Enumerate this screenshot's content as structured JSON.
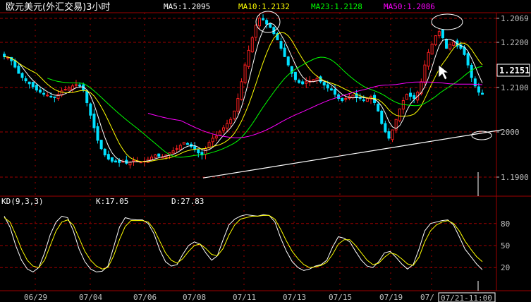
{
  "header": {
    "title": "欧元美元(外汇交易)3小时",
    "ma5": "MA5:1.2095",
    "ma10": "MA10:1.2132",
    "ma23": "MA23:1.2128",
    "ma50": "MA50:1.2086"
  },
  "kd_header": {
    "name": "KD(9,3,3)",
    "k": "K:17.05",
    "d": "D:27.83"
  },
  "current_price": "1.2151",
  "cursor_time": "07/21-11:00",
  "colors": {
    "background": "#000000",
    "up_candle": "#ff2020",
    "down_candle": "#00e0ff",
    "ma5": "#ffffff",
    "ma10": "#ffff00",
    "ma23": "#00ff00",
    "ma50": "#ff00ff",
    "grid": "#a00000",
    "axis": "#c0c0c0",
    "trendline": "#ffffff",
    "k_line": "#ffffff",
    "d_line": "#ffff00"
  },
  "chart_data": [
    {
      "type": "candlestick",
      "title": "欧元美元(外汇交易)3小时",
      "y_ticks": [
        "1.2069",
        "1.2200",
        "1.2100",
        "2000",
        "1.1900"
      ],
      "ylim": [
        1.185,
        1.2275
      ],
      "x_ticks": [
        "06/29",
        "07/04",
        "07/06",
        "07/08",
        "07/11",
        "07/13",
        "07/15",
        "07/19",
        "07/",
        "07/21-11:00"
      ],
      "grid": true,
      "series": [
        {
          "name": "MA5",
          "last": 1.2095
        },
        {
          "name": "MA10",
          "last": 1.2132
        },
        {
          "name": "MA23",
          "last": 1.2128
        },
        {
          "name": "MA50",
          "last": 1.2086
        }
      ],
      "close_approx": [
        1.217,
        1.2168,
        1.216,
        1.2145,
        1.213,
        1.212,
        1.2112,
        1.2105,
        1.2098,
        1.209,
        1.2085,
        1.208,
        1.2078,
        1.2075,
        1.2072,
        1.208,
        1.2088,
        1.2092,
        1.2095,
        1.21,
        1.2103,
        1.21,
        1.209,
        1.206,
        1.203,
        1.2,
        1.197,
        1.195,
        1.1935,
        1.1925,
        1.192,
        1.1918,
        1.1917,
        1.192,
        1.1915,
        1.1918,
        1.1922,
        1.192,
        1.1918,
        1.192,
        1.1925,
        1.193,
        1.1935,
        1.1932,
        1.193,
        1.1935,
        1.194,
        1.1945,
        1.195,
        1.1958,
        1.1965,
        1.196,
        1.1955,
        1.1948,
        1.194,
        1.1935,
        1.195,
        1.1965,
        1.1975,
        1.198,
        1.199,
        1.2,
        1.201,
        1.202,
        1.204,
        1.207,
        1.211,
        1.215,
        1.2185,
        1.2215,
        1.2245,
        1.2262,
        1.2258,
        1.2248,
        1.224,
        1.2225,
        1.221,
        1.219,
        1.217,
        1.215,
        1.213,
        1.2115,
        1.2108,
        1.2105,
        1.211,
        1.2112,
        1.2115,
        1.2118,
        1.211,
        1.2102,
        1.2095,
        1.209,
        1.208,
        1.207,
        1.2065,
        1.207,
        1.2075,
        1.2078,
        1.2072,
        1.207,
        1.2065,
        1.207,
        1.2075,
        1.206,
        1.204,
        1.201,
        1.199,
        1.1975,
        1.1995,
        1.202,
        1.2045,
        1.2065,
        1.208,
        1.2075,
        1.207,
        1.2085,
        1.211,
        1.215,
        1.218,
        1.22,
        1.222,
        1.223,
        1.2215,
        1.219,
        1.22,
        1.2205,
        1.2195,
        1.219,
        1.2175,
        1.215,
        1.212,
        1.21,
        1.2085,
        1.208
      ],
      "trendline": {
        "from": [
          1.188
        ],
        "to": [
          1.1995
        ]
      }
    },
    {
      "type": "line",
      "title": "KD(9,3,3)",
      "y_ticks": [
        "80",
        "50",
        "20"
      ],
      "ylim": [
        0,
        100
      ],
      "series": [
        {
          "name": "K",
          "last": 17.05,
          "values": [
            90,
            75,
            50,
            30,
            18,
            14,
            20,
            40,
            65,
            82,
            90,
            88,
            70,
            45,
            28,
            18,
            14,
            15,
            22,
            48,
            75,
            88,
            86,
            85,
            85,
            80,
            66,
            44,
            28,
            22,
            24,
            38,
            50,
            55,
            52,
            40,
            30,
            36,
            58,
            78,
            86,
            90,
            92,
            91,
            90,
            92,
            91,
            82,
            60,
            42,
            28,
            20,
            16,
            18,
            22,
            24,
            30,
            48,
            62,
            60,
            55,
            42,
            30,
            22,
            20,
            28,
            40,
            42,
            34,
            25,
            18,
            24,
            45,
            70,
            80,
            82,
            84,
            85,
            78,
            62,
            45,
            35,
            25,
            17
          ]
        },
        {
          "name": "D",
          "last": 27.83,
          "values": [
            88,
            82,
            65,
            45,
            30,
            22,
            20,
            30,
            50,
            70,
            82,
            85,
            78,
            60,
            42,
            30,
            22,
            18,
            20,
            36,
            58,
            76,
            84,
            84,
            84,
            82,
            72,
            56,
            40,
            30,
            26,
            32,
            42,
            50,
            52,
            46,
            38,
            36,
            46,
            64,
            78,
            86,
            88,
            90,
            90,
            91,
            91,
            86,
            72,
            56,
            42,
            32,
            24,
            20,
            21,
            23,
            27,
            38,
            52,
            58,
            58,
            50,
            40,
            30,
            24,
            26,
            34,
            40,
            38,
            32,
            25,
            23,
            34,
            55,
            70,
            78,
            82,
            84,
            80,
            70,
            56,
            45,
            35,
            28
          ]
        }
      ]
    }
  ]
}
